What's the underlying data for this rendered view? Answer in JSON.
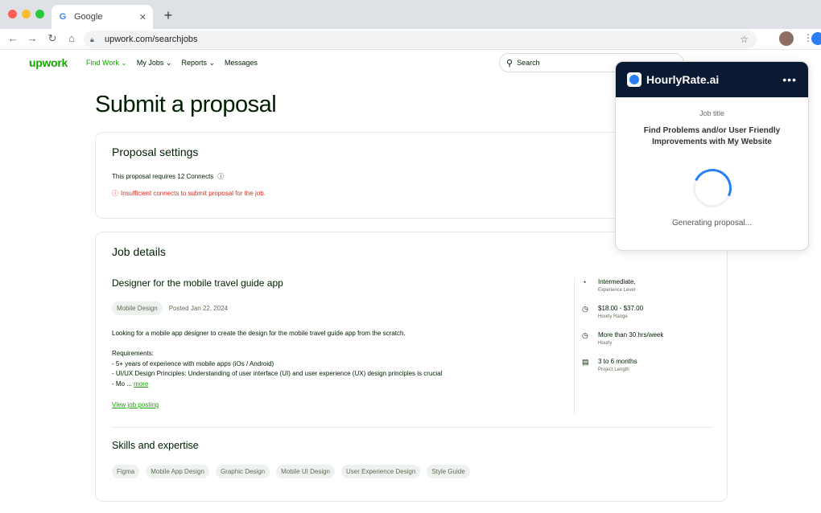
{
  "browser": {
    "tab_title": "Google",
    "url": "upwork.com/searchjobs"
  },
  "upwork": {
    "logo": "upwork",
    "nav": [
      "Find Work",
      "My Jobs",
      "Reports",
      "Messages"
    ],
    "search_placeholder": "Search"
  },
  "page": {
    "title": "Submit a proposal"
  },
  "proposal_settings": {
    "heading": "Proposal settings",
    "connects_text": "This proposal requires 12 Connects",
    "error": "Insufficient connects to submit proposal for the job."
  },
  "job_details": {
    "heading": "Job details",
    "title": "Designer for the mobile travel guide app",
    "category": "Mobile Design",
    "posted": "Posted Jan 22, 2024",
    "description": "Looking for a mobile app designer to create the design for the mobile travel guide app from the scratch.",
    "requirements_label": "Requirements:",
    "requirements": [
      "- 5+ years of experience with mobile apps (iOs / Android)",
      "- UI/UX Design Principles: Understanding of user interface (UI) and user experience (UX) design principles is crucial",
      "- Mo ..."
    ],
    "more_link": "more",
    "view_link": "View job posting",
    "meta": [
      {
        "value": "Intermediate,",
        "label": "Experience Level",
        "icon": "level-icon"
      },
      {
        "value": "$18.00 - $37.00",
        "label": "Hourly Range",
        "icon": "clock-icon"
      },
      {
        "value": "More than 30 hrs/week",
        "label": "Hourly",
        "icon": "clock-icon"
      },
      {
        "value": "3 to 6 months",
        "label": "Project Length",
        "icon": "calendar-icon"
      }
    ]
  },
  "skills": {
    "heading": "Skills and expertise",
    "items": [
      "Figma",
      "Mobile App Design",
      "Graphic Design",
      "Mobile UI Design",
      "User Experience Design",
      "Style Guide"
    ]
  },
  "hourlyrate": {
    "brand": "HourlyRate.ai",
    "job_title_label": "Job title",
    "job_title": "Find Problems and/or User Friendly Improvements with My Website",
    "status": "Generating proposal..."
  },
  "colors": {
    "upwork_green": "#14a800",
    "error_red": "#d93025",
    "popup_header": "#0b1a33",
    "accent_blue": "#2a7ff5"
  }
}
